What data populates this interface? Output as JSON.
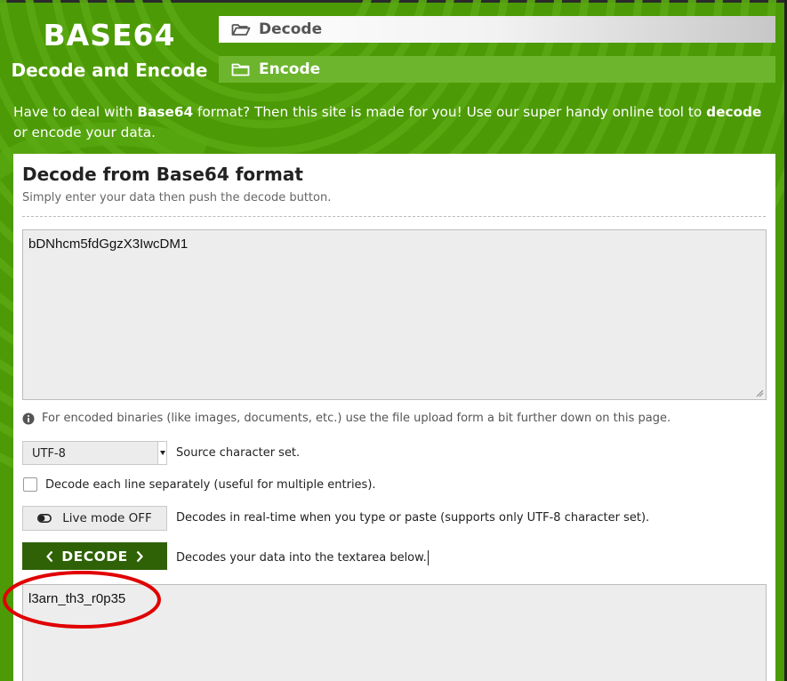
{
  "logo": {
    "title": "BASE64",
    "subtitle": "Decode and Encode"
  },
  "nav": {
    "decode_label": "Decode",
    "encode_label": "Encode",
    "decode_icon": "folder-open-icon",
    "encode_icon": "folder-icon"
  },
  "intro": {
    "part1": "Have to deal with ",
    "bold1": "Base64",
    "part2": " format? Then this site is made for you! Use our super handy online tool to ",
    "bold2": "decode",
    "part3": " or encode your data."
  },
  "panel": {
    "title": "Decode from Base64 format",
    "subtitle": "Simply enter your data then push the decode button."
  },
  "input": {
    "value": "bDNhcm5fdGgzX3IwcDM1"
  },
  "note": "For encoded binaries (like images, documents, etc.) use the file upload form a bit further down on this page.",
  "charset": {
    "selected": "UTF-8",
    "label": "Source character set."
  },
  "each_line": {
    "label": "Decode each line separately (useful for multiple entries).",
    "checked": false
  },
  "live_mode": {
    "label": "Live mode OFF",
    "description": "Decodes in real-time when you type or paste (supports only UTF-8 character set)."
  },
  "decode_button": {
    "label": "DECODE",
    "description": "Decodes your data into the textarea below."
  },
  "output": {
    "value": "l3arn_th3_r0p35"
  },
  "colors": {
    "brand_green": "#4c9a05",
    "nav_encode": "#6cb52d",
    "decode_button": "#2f6206",
    "annotation_circle": "#e00000"
  }
}
